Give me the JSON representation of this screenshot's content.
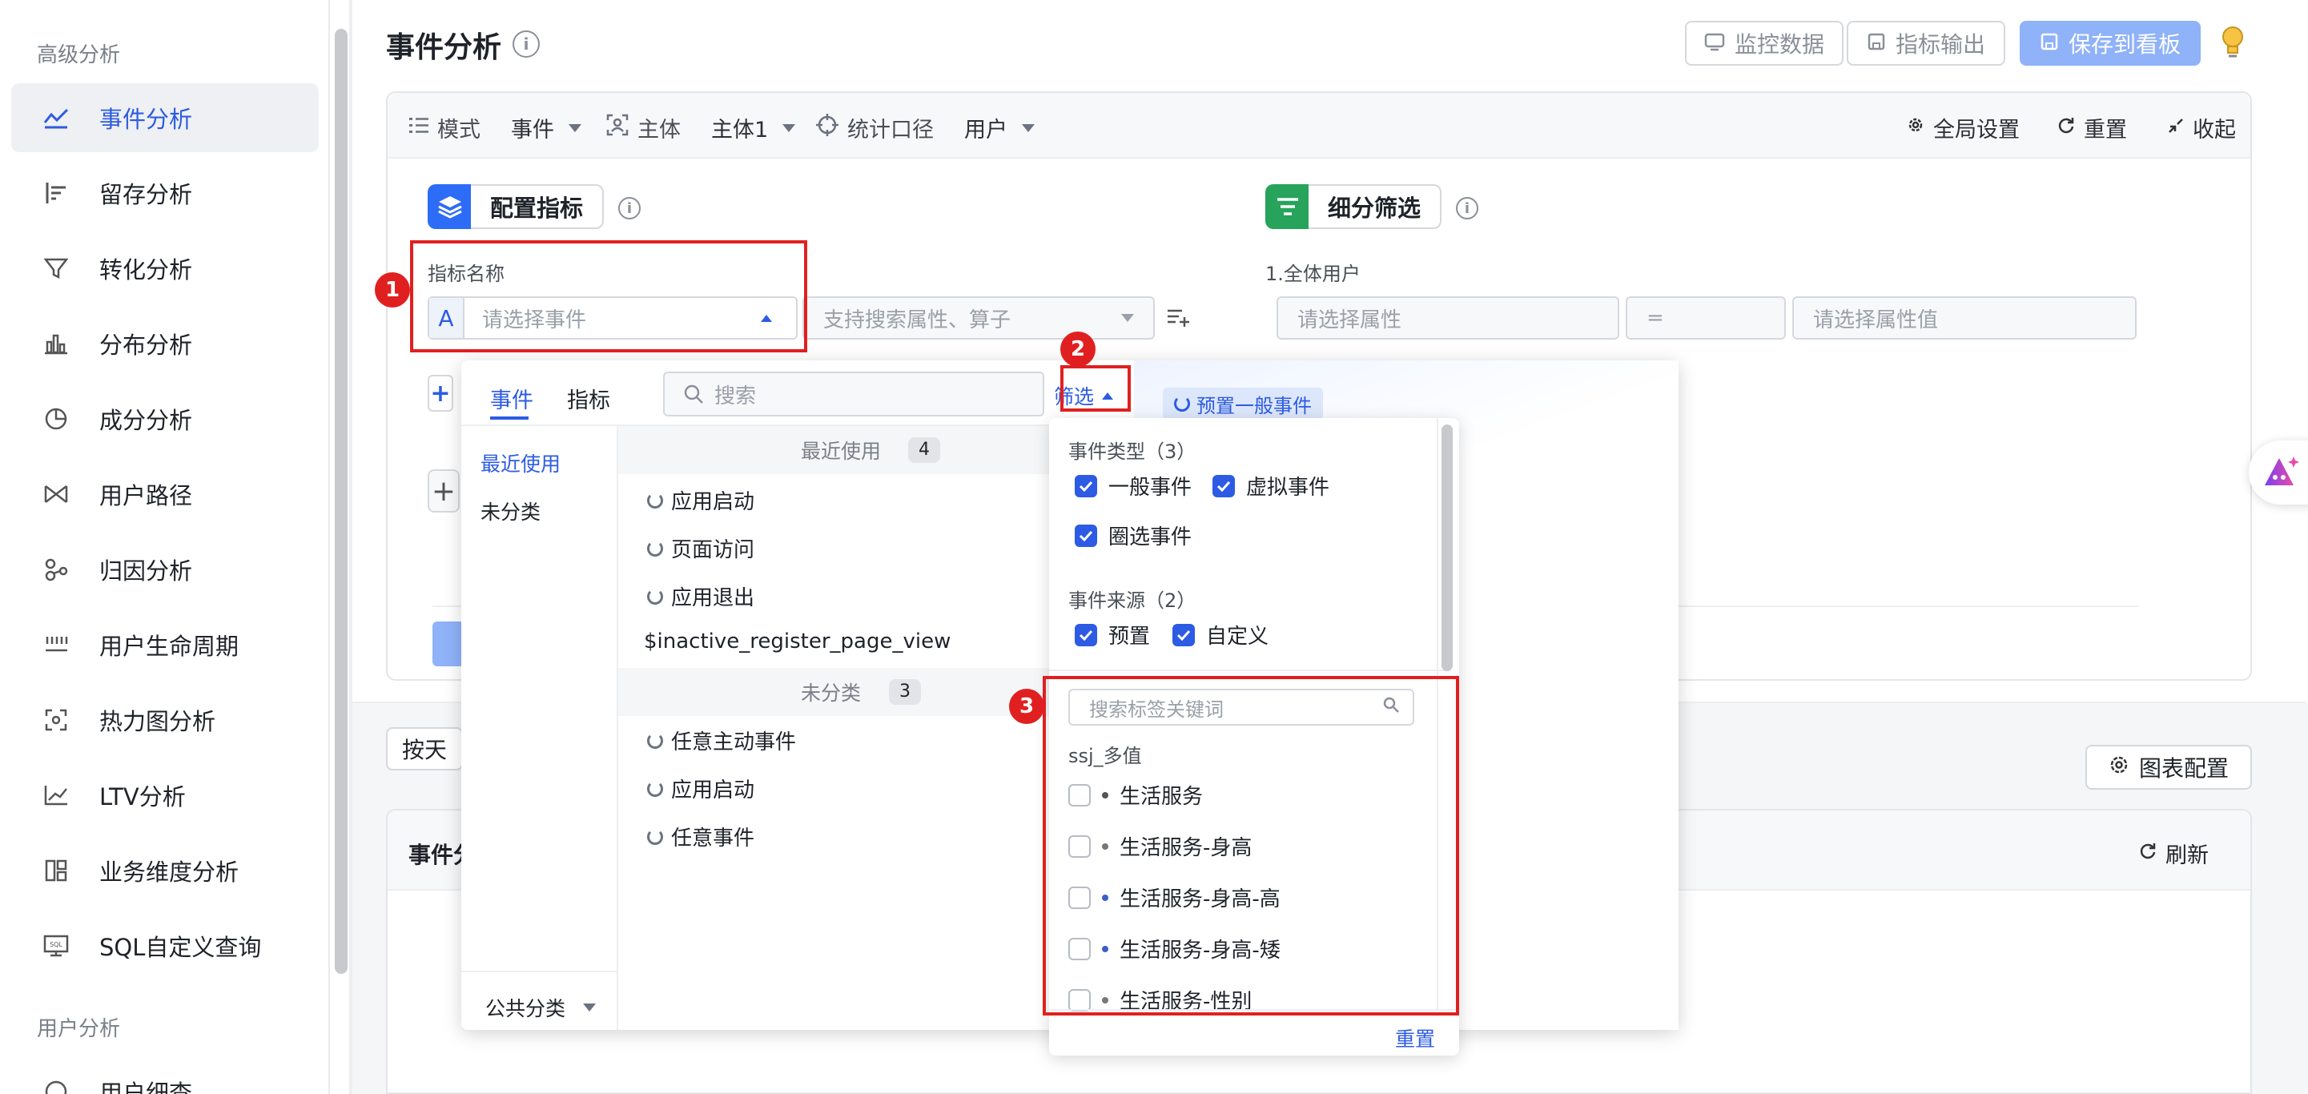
{
  "sidebar": {
    "section_advanced": "高级分析",
    "items": [
      {
        "label": "事件分析",
        "icon": "event-analysis-icon",
        "active": true
      },
      {
        "label": "留存分析",
        "icon": "retention-icon"
      },
      {
        "label": "转化分析",
        "icon": "funnel-icon"
      },
      {
        "label": "分布分析",
        "icon": "distribution-icon"
      },
      {
        "label": "成分分析",
        "icon": "composition-icon"
      },
      {
        "label": "用户路径",
        "icon": "path-icon"
      },
      {
        "label": "归因分析",
        "icon": "attribution-icon"
      },
      {
        "label": "用户生命周期",
        "icon": "lifecycle-icon"
      },
      {
        "label": "热力图分析",
        "icon": "heatmap-icon"
      },
      {
        "label": "LTV分析",
        "icon": "ltv-icon"
      },
      {
        "label": "业务维度分析",
        "icon": "dimension-icon"
      },
      {
        "label": "SQL自定义查询",
        "icon": "sql-icon"
      }
    ],
    "section_user": "用户分析",
    "cut_item": "用户细查"
  },
  "header": {
    "title": "事件分析",
    "monitor": "监控数据",
    "export": "指标输出",
    "save": "保存到看板"
  },
  "toolbar": {
    "mode_label": "模式",
    "mode_value": "事件",
    "subject_label": "主体",
    "subject_value": "主体1",
    "scope_label": "统计口径",
    "scope_value": "用户",
    "global": "全局设置",
    "reset": "重置",
    "collapse": "收起"
  },
  "config": {
    "title": "配置指标",
    "metric_name_label": "指标名称",
    "prefix": "A",
    "event_placeholder": "请选择事件",
    "attr_placeholder": "支持搜索属性、算子"
  },
  "breakdown": {
    "title": "细分筛选",
    "group_label": "1.全体用户",
    "attr_placeholder": "请选择属性",
    "op": "=",
    "value_placeholder": "请选择属性值"
  },
  "dropdown": {
    "tabs": [
      "事件",
      "指标"
    ],
    "search_placeholder": "搜索",
    "filter": "筛选",
    "categories": [
      "最近使用",
      "未分类"
    ],
    "footer": "公共分类",
    "recent_group": "最近使用",
    "recent_count": "4",
    "recent_items": [
      "应用启动",
      "页面访问",
      "应用退出",
      "$inactive_register_page_view"
    ],
    "uncat_group": "未分类",
    "uncat_count": "3",
    "uncat_items": [
      "任意主动事件",
      "应用启动",
      "任意事件"
    ],
    "tag_preset": "预置一般事件"
  },
  "filter_panel": {
    "type_title": "事件类型（3）",
    "types": [
      "一般事件",
      "虚拟事件",
      "圈选事件"
    ],
    "source_title": "事件来源（2）",
    "sources": [
      "预置",
      "自定义"
    ],
    "tag_search_placeholder": "搜索标签关键词",
    "tag_group": "ssj_多值",
    "tags": [
      "生活服务",
      "生活服务-身高",
      "生活服务-身高-高",
      "生活服务-身高-矮",
      "生活服务-性别"
    ],
    "reset": "重置"
  },
  "bottom": {
    "by_day": "按天",
    "chart_config": "图表配置",
    "event_partial": "事件分",
    "refresh": "刷新"
  },
  "annotations": [
    "1",
    "2",
    "3"
  ]
}
